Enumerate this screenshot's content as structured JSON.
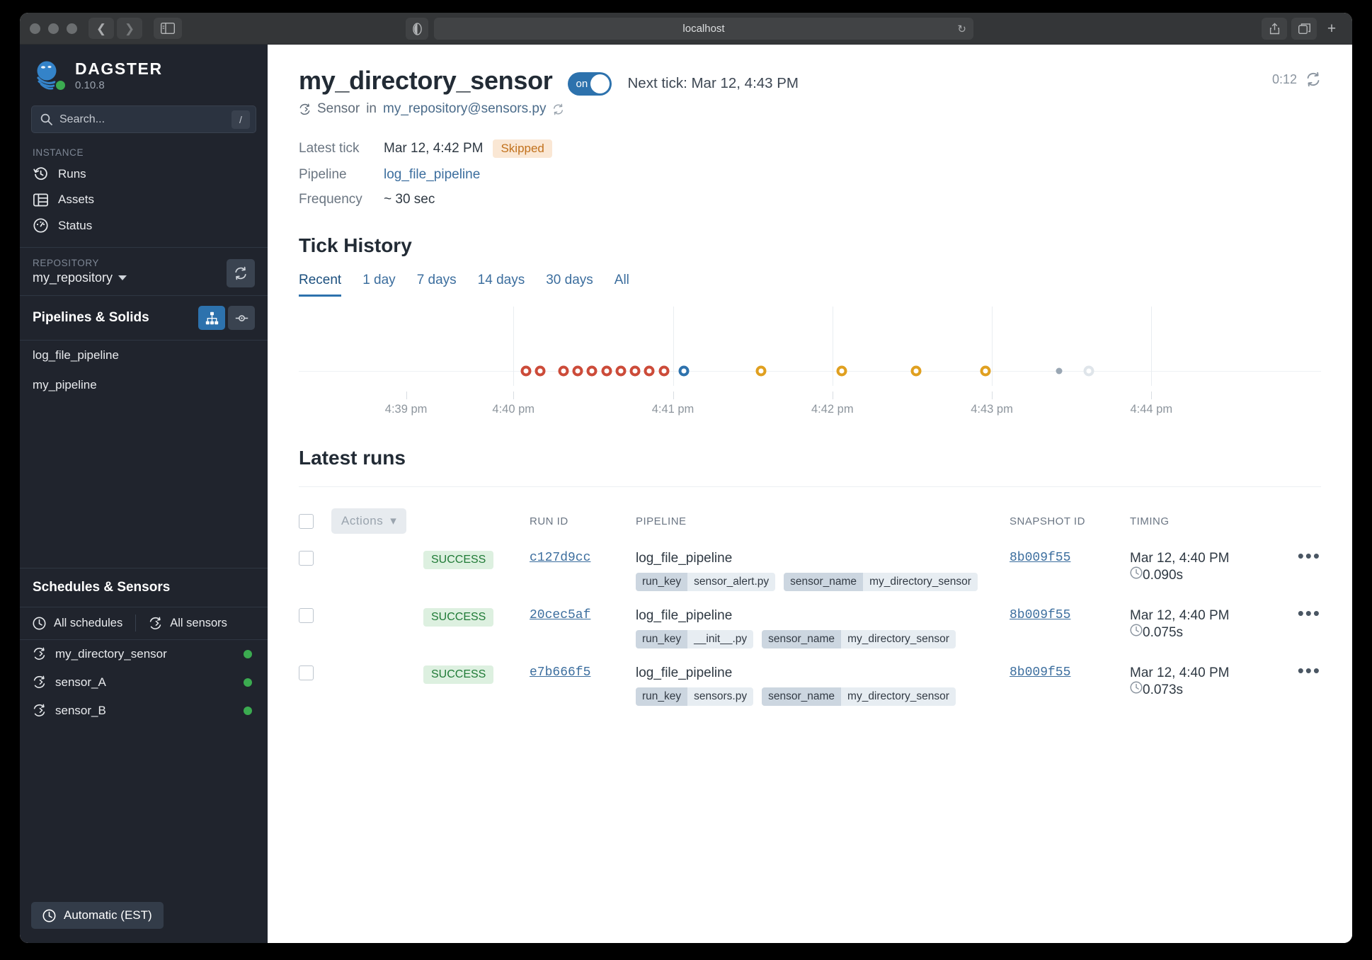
{
  "browser": {
    "url": "localhost",
    "back_icon": "chevron-left-icon",
    "forward_icon": "chevron-right-icon",
    "sidebar_icon": "sidebar-toggle-icon",
    "reload_icon": "reload-icon",
    "share_icon": "share-icon",
    "tabs_icon": "tab-overview-icon",
    "new_tab_label": "+"
  },
  "sidebar": {
    "brand": {
      "name": "DAGSTER",
      "version": "0.10.8"
    },
    "search": {
      "placeholder": "Search...",
      "shortcut": "/"
    },
    "instance_label": "INSTANCE",
    "instance_items": [
      {
        "label": "Runs",
        "icon": "history-icon"
      },
      {
        "label": "Assets",
        "icon": "table-icon"
      },
      {
        "label": "Status",
        "icon": "gauge-icon"
      }
    ],
    "repository_label": "REPOSITORY",
    "repository_name": "my_repository",
    "reload_repo_icon": "refresh-icon",
    "pipelines_header": "Pipelines & Solids",
    "view_toggle": [
      {
        "icon": "pipeline-graph-icon",
        "active": true
      },
      {
        "icon": "solid-node-icon",
        "active": false
      }
    ],
    "pipelines": [
      "log_file_pipeline",
      "my_pipeline"
    ],
    "schedules_sensors_header": "Schedules & Sensors",
    "all_schedules_label": "All schedules",
    "all_sensors_label": "All sensors",
    "sensors": [
      {
        "label": "my_directory_sensor",
        "status_color": "#3bab50"
      },
      {
        "label": "sensor_A",
        "status_color": "#3bab50"
      },
      {
        "label": "sensor_B",
        "status_color": "#3bab50"
      }
    ],
    "timezone_button": "Automatic (EST)"
  },
  "header": {
    "title": "my_directory_sensor",
    "toggle_label": "on",
    "toggle_on": true,
    "next_tick": "Next tick: Mar 12, 4:43 PM",
    "countdown": "0:12",
    "countdown_icon": "refresh-icon",
    "subhead_icon": "sensor-icon",
    "subhead_prefix": "Sensor",
    "subhead_in": "in",
    "subhead_target": "my_repository@sensors.py",
    "subhead_refresh_icon": "refresh-icon"
  },
  "meta": {
    "rows": [
      {
        "key": "Latest tick",
        "value": "Mar 12, 4:42 PM",
        "badge": "Skipped"
      },
      {
        "key": "Pipeline",
        "value": "log_file_pipeline",
        "link": true
      },
      {
        "key": "Frequency",
        "value": "~ 30 sec"
      }
    ]
  },
  "tick_history": {
    "title": "Tick History",
    "tabs": [
      {
        "label": "Recent",
        "active": true
      },
      {
        "label": "1 day",
        "active": false
      },
      {
        "label": "7 days",
        "active": false
      },
      {
        "label": "14 days",
        "active": false
      },
      {
        "label": "30 days",
        "active": false
      },
      {
        "label": "All",
        "active": false
      }
    ]
  },
  "chart_data": {
    "type": "scatter",
    "title": "Tick History",
    "xlabel": "",
    "ylabel": "",
    "xtick_labels": [
      "4:39 pm",
      "4:40 pm",
      "4:41 pm",
      "4:42 pm",
      "4:43 pm",
      "4:44 pm"
    ],
    "xtick_positions_pct": [
      10.5,
      21.0,
      36.6,
      52.2,
      67.8,
      83.4,
      99.0
    ],
    "grid": true,
    "legend": null,
    "series": [
      {
        "name": "failure",
        "color": "#cc4b39",
        "style": "ring",
        "points_pct": [
          22.2,
          23.6,
          25.9,
          27.3,
          28.7,
          30.1,
          31.5,
          32.9,
          34.3,
          35.7
        ]
      },
      {
        "name": "started",
        "color": "#2d72ad",
        "style": "ring",
        "points_pct": [
          37.7
        ]
      },
      {
        "name": "skipped",
        "color": "#e0a020",
        "style": "ring",
        "points_pct": [
          45.2,
          53.1,
          60.4,
          67.2
        ]
      },
      {
        "name": "pending-small",
        "color": "#9aa7b4",
        "style": "dot-small",
        "points_pct": [
          74.4
        ]
      },
      {
        "name": "future",
        "color": "#dfe5ea",
        "style": "ring",
        "points_pct": [
          77.3
        ]
      }
    ]
  },
  "latest_runs": {
    "title": "Latest runs",
    "actions_label": "Actions",
    "columns": [
      "RUN ID",
      "PIPELINE",
      "SNAPSHOT ID",
      "TIMING"
    ],
    "rows": [
      {
        "status": "SUCCESS",
        "run_id": "c127d9cc",
        "pipeline": "log_file_pipeline",
        "tags": [
          {
            "key": "run_key",
            "value": "sensor_alert.py"
          },
          {
            "key": "sensor_name",
            "value": "my_directory_sensor"
          }
        ],
        "snapshot_id": "8b009f55",
        "time": "Mar 12, 4:40 PM",
        "duration": "0.090s"
      },
      {
        "status": "SUCCESS",
        "run_id": "20cec5af",
        "pipeline": "log_file_pipeline",
        "tags": [
          {
            "key": "run_key",
            "value": "__init__.py"
          },
          {
            "key": "sensor_name",
            "value": "my_directory_sensor"
          }
        ],
        "snapshot_id": "8b009f55",
        "time": "Mar 12, 4:40 PM",
        "duration": "0.075s"
      },
      {
        "status": "SUCCESS",
        "run_id": "e7b666f5",
        "pipeline": "log_file_pipeline",
        "tags": [
          {
            "key": "run_key",
            "value": "sensors.py"
          },
          {
            "key": "sensor_name",
            "value": "my_directory_sensor"
          }
        ],
        "snapshot_id": "8b009f55",
        "time": "Mar 12, 4:40 PM",
        "duration": "0.073s"
      }
    ]
  }
}
